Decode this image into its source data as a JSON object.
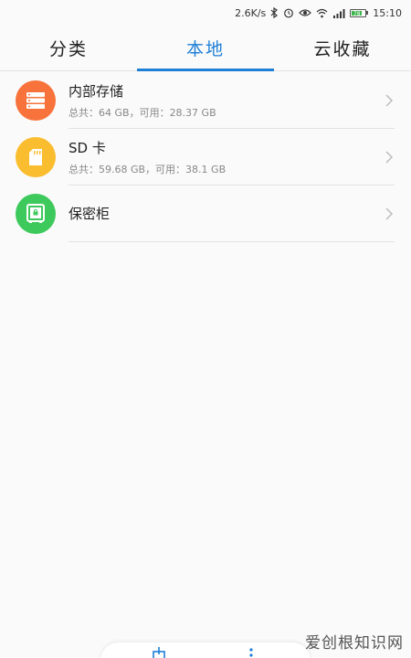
{
  "status_bar": {
    "network_speed": "2.6K/s",
    "battery_level": "78",
    "time": "15:10"
  },
  "tabs": [
    {
      "label": "分类",
      "active": false
    },
    {
      "label": "本地",
      "active": true
    },
    {
      "label": "云收藏",
      "active": false
    }
  ],
  "storage": [
    {
      "title": "内部存储",
      "subtitle": "总共：64 GB，可用：28.37 GB",
      "icon": "storage-icon",
      "color": "#f7733b"
    },
    {
      "title": "SD 卡",
      "subtitle": "总共：59.68 GB，可用：38.1 GB",
      "icon": "sd-card-icon",
      "color": "#fbbd30"
    },
    {
      "title": "保密柜",
      "subtitle": "",
      "icon": "safe-icon",
      "color": "#3ec95c"
    }
  ],
  "accent_color": "#1e7fd6",
  "watermark": "爱创根知识网"
}
